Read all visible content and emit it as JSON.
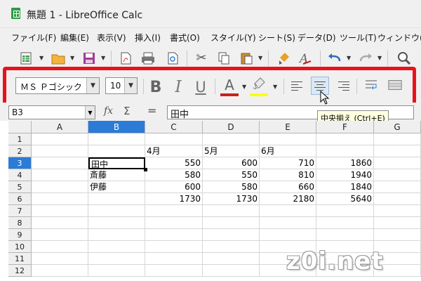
{
  "window": {
    "title": "無題 1 - LibreOffice Calc"
  },
  "menu": [
    {
      "label": "ファイル(F)",
      "name": "menu-file"
    },
    {
      "label": "編集(E)",
      "name": "menu-edit"
    },
    {
      "label": "表示(V)",
      "name": "menu-view"
    },
    {
      "label": "挿入(I)",
      "name": "menu-insert"
    },
    {
      "label": "書式(O)",
      "name": "menu-format"
    },
    {
      "label": "スタイル(Y)",
      "name": "menu-styles"
    },
    {
      "label": "シート(S)",
      "name": "menu-sheet"
    },
    {
      "label": "データ(D)",
      "name": "menu-data"
    },
    {
      "label": "ツール(T)",
      "name": "menu-tools"
    },
    {
      "label": "ウィンドウ(W)",
      "name": "menu-window"
    }
  ],
  "formatting": {
    "font_name": "ＭＳ Ｐゴシック",
    "font_size": "10",
    "bold_label": "B",
    "italic_label": "I",
    "underline_label": "U",
    "font_color_label": "A",
    "font_color": "#c9211e",
    "highlight_color": "#ffff00",
    "active_alignment": "center"
  },
  "tooltip": {
    "text": "中央揃え (Ctrl+E)"
  },
  "formula_bar": {
    "name_box": "B3",
    "fx_label": "fx",
    "sum_label": "Σ",
    "equals_label": "=",
    "content": "田中"
  },
  "sheet": {
    "columns": [
      "A",
      "B",
      "C",
      "D",
      "E",
      "F",
      "G"
    ],
    "selected_column": "B",
    "rows": [
      "1",
      "2",
      "3",
      "4",
      "5",
      "6",
      "7",
      "8",
      "9",
      "10",
      "11",
      "12"
    ],
    "selected_row": "3",
    "active_cell": "B3",
    "cells": {
      "C2": "4月",
      "D2": "5月",
      "E2": "6月",
      "B3": "田中",
      "C3": "550",
      "D3": "600",
      "E3": "710",
      "F3": "1860",
      "B4": "斎藤",
      "C4": "580",
      "D4": "550",
      "E4": "810",
      "F4": "1940",
      "B5": "伊藤",
      "C5": "600",
      "D5": "580",
      "E5": "660",
      "F5": "1840",
      "C6": "1730",
      "D6": "1730",
      "E6": "2180",
      "F6": "5640"
    }
  },
  "watermark": "z0i.net"
}
